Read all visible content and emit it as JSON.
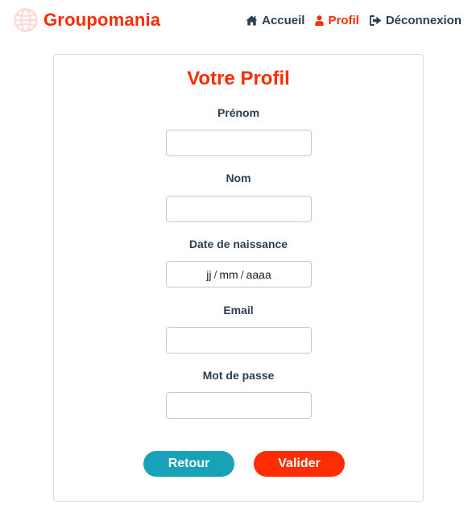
{
  "brand": {
    "name": "Groupomania",
    "color": "#fd2d01",
    "icon": "globe-logo-icon"
  },
  "nav": {
    "items": [
      {
        "label": "Accueil",
        "icon": "home-icon",
        "active": false
      },
      {
        "label": "Profil",
        "icon": "user-icon",
        "active": true
      },
      {
        "label": "Déconnexion",
        "icon": "sign-out-icon",
        "active": false
      }
    ]
  },
  "form": {
    "title": "Votre Profil",
    "fields": {
      "first_name": {
        "label": "Prénom",
        "value": ""
      },
      "last_name": {
        "label": "Nom",
        "value": ""
      },
      "birth_date": {
        "label": "Date de naissance",
        "day": "jj",
        "month": "mm",
        "year": "aaaa",
        "separator": "/"
      },
      "email": {
        "label": "Email",
        "value": ""
      },
      "password": {
        "label": "Mot de passe",
        "value": ""
      }
    },
    "buttons": {
      "back": "Retour",
      "submit": "Valider"
    }
  },
  "colors": {
    "accent": "#fd2d01",
    "secondary_button": "#17a2b8",
    "text": "#2c3e50"
  }
}
